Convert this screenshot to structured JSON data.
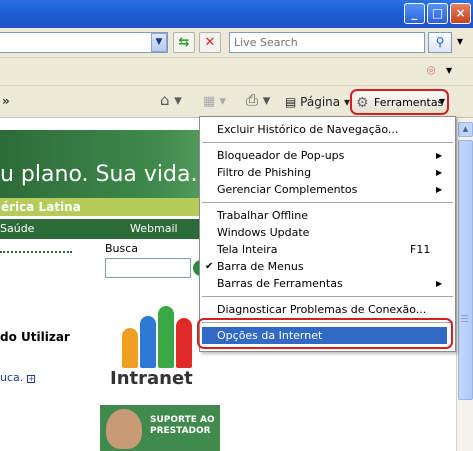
{
  "window": {
    "controls": {
      "minimize": "_",
      "maximize": "□",
      "close": "×"
    }
  },
  "address_bar": {
    "dropdown_icon": "chevron-down-icon",
    "go_icon": "refresh-go-icon",
    "stop_icon": "stop-icon",
    "search_placeholder": "Live Search",
    "search_icon": "search-icon"
  },
  "command_bar": {
    "page_label": "Página",
    "tools_label": "Ferramentas"
  },
  "tools_menu": {
    "items": [
      {
        "label": "Excluir Histórico de Navegação..."
      },
      {
        "label": "Bloqueador de Pop-ups",
        "submenu": true
      },
      {
        "label": "Filtro de Phishing",
        "submenu": true
      },
      {
        "label": "Gerenciar Complementos",
        "submenu": true
      },
      {
        "label": "Trabalhar Offline"
      },
      {
        "label": "Windows Update"
      },
      {
        "label": "Tela Inteira",
        "shortcut": "F11"
      },
      {
        "label": "Barra de Menus",
        "checked": true
      },
      {
        "label": "Barras de Ferramentas",
        "submenu": true
      },
      {
        "label": "Diagnosticar Problemas de Conexão..."
      },
      {
        "label": "Opções da Internet",
        "selected": true
      }
    ]
  },
  "web_content": {
    "banner_text": "u plano. Sua vida.",
    "region_label": "érica Latina",
    "nav_saude": "Saúde",
    "nav_webmail": "Webmail",
    "search_label": "Busca",
    "intranet_label": "Intranet",
    "support_banner": "SUPORTE AO PRESTADOR",
    "left_heading": "do Utilizar",
    "left_link": "uca."
  },
  "colors": {
    "titlebar": "#1f52c4",
    "menu_selection": "#316ac5",
    "highlight_outline": "#d42020",
    "site_green": "#2c6b38",
    "site_lime": "#b5cc5a"
  }
}
